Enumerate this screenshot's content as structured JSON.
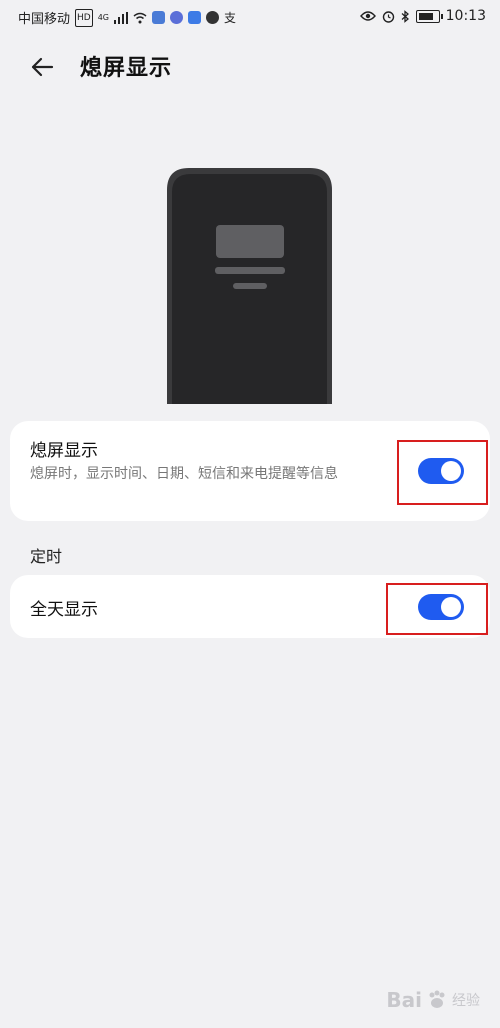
{
  "status_bar": {
    "carrier": "中国移动",
    "network_badge": "HD",
    "signal_label": "4G",
    "misc_glyph": "支",
    "time": "10:13"
  },
  "header": {
    "title": "熄屏显示",
    "back_icon": "arrow-left-icon"
  },
  "settings": {
    "aod": {
      "title": "熄屏显示",
      "description": "熄屏时，显示时间、日期、短信和来电提醒等信息",
      "enabled": true
    },
    "section_timing": "定时",
    "all_day": {
      "title": "全天显示",
      "enabled": true
    }
  },
  "colors": {
    "accent": "#1f5bf0",
    "highlight": "#d81e1e",
    "background": "#f1f1f3",
    "card": "#ffffff"
  },
  "watermark": {
    "brand": "Bai",
    "brand_suffix": "经验"
  }
}
